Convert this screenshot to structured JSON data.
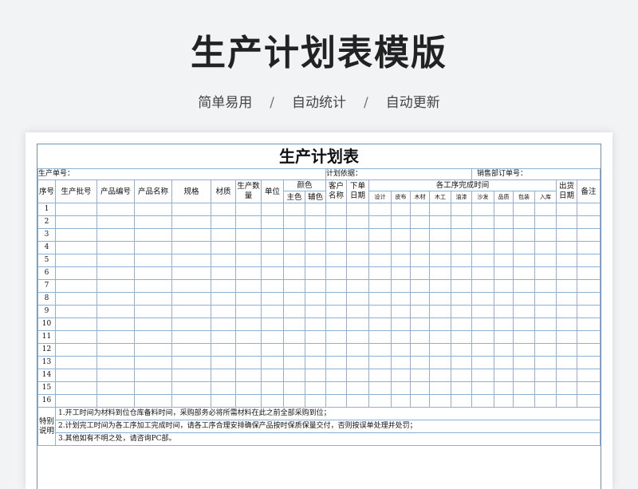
{
  "hero": {
    "title": "生产计划表模版",
    "tags": [
      "简单易用",
      "自动统计",
      "自动更新"
    ],
    "separator": "/"
  },
  "sheet": {
    "title": "生产计划表",
    "info": {
      "prod_no": "生产单号：",
      "plan_basis": "计划依据：",
      "sales_order": "销售部订单号："
    },
    "headers": {
      "seq": "序号",
      "batch": "生产批号",
      "prod_code": "产品编号",
      "prod_name": "产品名称",
      "spec": "规格",
      "material": "材质",
      "qty": "生产数量",
      "unit": "单位",
      "color": "颜色",
      "main_color": "主色",
      "aux_color": "辅色",
      "customer": "客户名称",
      "order_date": "下单日期",
      "process_time": "各工序完成时间",
      "processes": [
        "设计",
        "皮布",
        "木材",
        "木工",
        "油漆",
        "沙发",
        "品质",
        "包装",
        "入库"
      ],
      "ship_date": "出货日期",
      "remark": "备注"
    },
    "rows": [
      "1",
      "2",
      "3",
      "4",
      "5",
      "6",
      "7",
      "8",
      "9",
      "10",
      "11",
      "12",
      "13",
      "14",
      "15",
      "16"
    ],
    "notes_label": "特别说明",
    "notes": [
      "1.开工时间为材料到位仓库备料时间，采购部务必将所需材料在此之前全部采购到位；",
      "2.计划完工时间为各工序加工完成时间，请各工序合理安排确保产品按时保质保量交付，否则按误单处理并处罚；",
      "3.其他如有不明之处，请咨询PC部。"
    ]
  }
}
